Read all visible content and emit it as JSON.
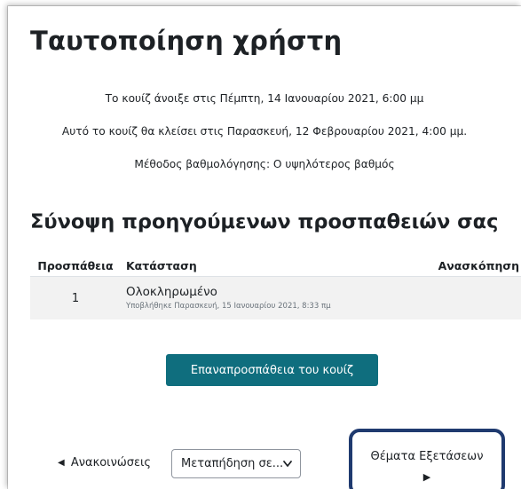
{
  "quiz": {
    "title": "Ταυτοποίηση χρήστη",
    "opened": "Το κουίζ άνοιξε στις Πέμπτη, 14 Ιανουαρίου 2021, 6:00 μμ",
    "closes": "Αυτό το κουίζ θα κλείσει στις Παρασκευή, 12 Φεβρουαρίου 2021, 4:00 μμ.",
    "grading": "Μέθοδος βαθμολόγησης: Ο υψηλότερος βαθμός"
  },
  "summary": {
    "heading": "Σύνοψη προηγούμενων προσπαθειών σας",
    "columns": {
      "attempt": "Προσπάθεια",
      "state": "Κατάσταση",
      "review": "Ανασκόπηση"
    },
    "rows": [
      {
        "attempt": "1",
        "state": "Ολοκληρωμένο",
        "submitted": "Υποβλήθηκε Παρασκευή, 15 Ιανουαρίου 2021, 8:33 πμ",
        "review": ""
      }
    ]
  },
  "actions": {
    "retry_label": "Επαναπροσπάθεια του κουίζ"
  },
  "navigation": {
    "prev_arrow": "◀",
    "prev_label": "Ανακοινώσεις",
    "jump_selected": "Μεταπήδηση σε...",
    "next_label": "Θέματα Εξετάσεων",
    "next_arrow": "▶"
  },
  "colors": {
    "accent": "#0f6e7e",
    "highlight_border": "#1f3a6f",
    "row_background": "#f2f2f2"
  }
}
